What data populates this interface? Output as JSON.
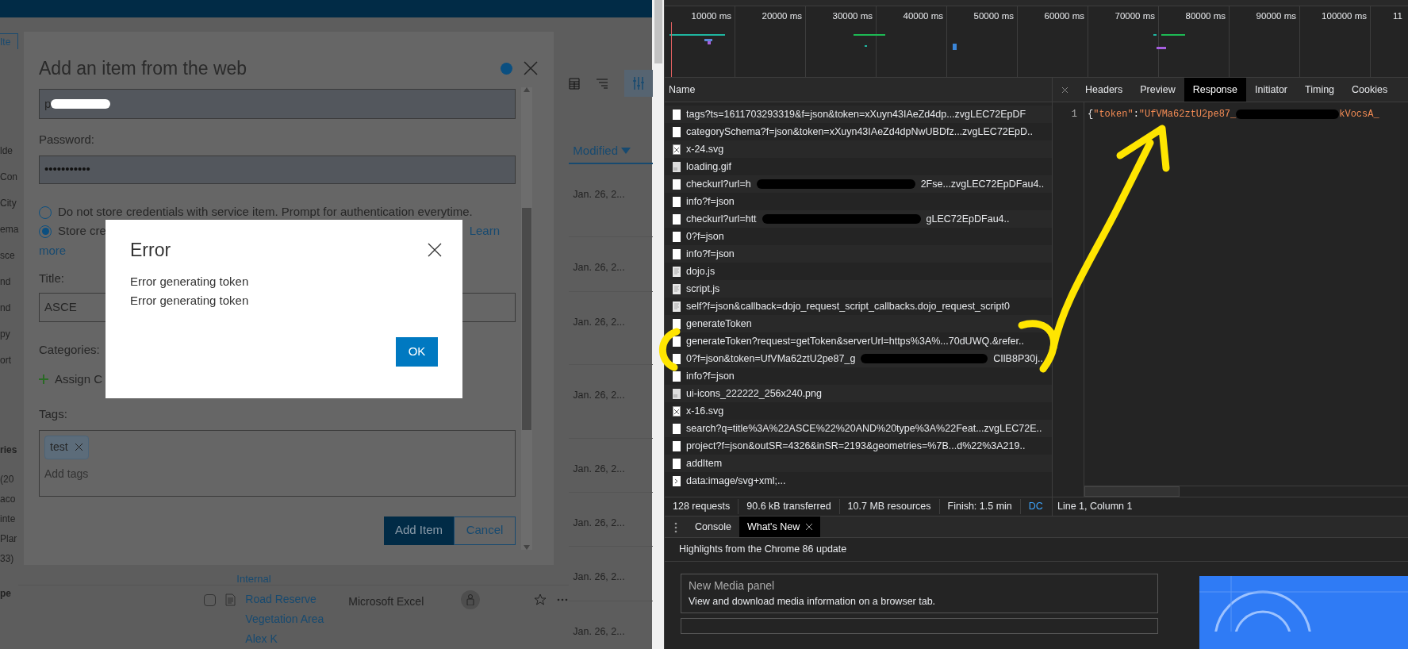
{
  "background_app": {
    "tab_fragment": "Ite",
    "sidebar_fragments_upper": [
      "lde",
      "Con",
      "City",
      "ema",
      "sce",
      "nd",
      "nd",
      "py",
      "ort"
    ],
    "sidebar_fragments_lower": [
      "ries",
      "(20",
      "aco",
      "inte",
      "Plar",
      "33)"
    ],
    "sidebar_fragment_bottom": "pe",
    "sort_header": "Modified",
    "dates": [
      "Jan. 26, 2...",
      "Jan. 26, 2...",
      "Jan. 26, 2...",
      "Jan. 26, 2...",
      "Jan. 26, 2...",
      "Jan. 26, 2...",
      "Jan. 26, 2...",
      "Jan. 26, 2..."
    ],
    "row_fragment": "Internal",
    "item": {
      "checked": false,
      "title_lines": [
        "Road Reserve",
        "Vegetation Area"
      ],
      "owner": "Alex K",
      "type": "Microsoft Excel"
    }
  },
  "dialog": {
    "title": "Add an item from the web",
    "username_value": "p",
    "password_label": "Password:",
    "password_value": "•••••••••••",
    "options": [
      {
        "label": "Do not store credentials with service item. Prompt for authentication everytime.",
        "selected": false
      },
      {
        "label": "Store cre",
        "link": "Learn",
        "link_second_line": "more",
        "selected": true
      }
    ],
    "title_label": "Title:",
    "title_value": "ASCE",
    "categories_label": "Categories:",
    "assign_label": "Assign C",
    "tags_label": "Tags:",
    "tags": [
      "test"
    ],
    "tags_placeholder": "Add tags",
    "buttons": [
      {
        "label": "Add Item",
        "kind": "primary"
      },
      {
        "label": "Cancel",
        "kind": "secondary"
      }
    ]
  },
  "error_modal": {
    "title": "Error",
    "messages": [
      "Error generating token",
      "Error generating token"
    ],
    "button": "OK"
  },
  "devtools": {
    "timeline_ticks": [
      "10000 ms",
      "20000 ms",
      "30000 ms",
      "40000 ms",
      "50000 ms",
      "60000 ms",
      "70000 ms",
      "80000 ms",
      "90000 ms",
      "100000 ms",
      "11"
    ],
    "name_header": "Name",
    "requests": [
      {
        "kind": "doc",
        "name": "tags?ts=1611703293319&f=json&token=xXuyn43IAeZd4dp...zvgLEC72EpDF"
      },
      {
        "kind": "doc",
        "name": "categorySchema?f=json&token=xXuyn43IAeZd4dpNwUBDfz...zvgLEC72EpD.."
      },
      {
        "kind": "x",
        "name": "x-24.svg"
      },
      {
        "kind": "img",
        "name": "loading.gif"
      },
      {
        "kind": "doc",
        "name": "checkurl?url=h",
        "tail": "2Fse...zvgLEC72EpDFau4.."
      },
      {
        "kind": "doc",
        "name": "info?f=json"
      },
      {
        "kind": "doc",
        "name": "checkurl?url=htt",
        "tail": "gLEC72EpDFau4.."
      },
      {
        "kind": "doc",
        "name": "0?f=json"
      },
      {
        "kind": "doc",
        "name": "info?f=json"
      },
      {
        "kind": "script",
        "name": "dojo.js"
      },
      {
        "kind": "script",
        "name": "script.js"
      },
      {
        "kind": "script",
        "name": "self?f=json&callback=dojo_request_script_callbacks.dojo_request_script0"
      },
      {
        "kind": "doc",
        "name": "generateToken"
      },
      {
        "kind": "doc",
        "name": "generateToken?request=getToken&serverUrl=https%3A%...70dUWQ.&refer.."
      },
      {
        "kind": "doc",
        "name": "0?f=json&token=UfVMa62ztU2pe87_g",
        "tail": "CIlB8P30j.."
      },
      {
        "kind": "doc",
        "name": "info?f=json"
      },
      {
        "kind": "img",
        "name": "ui-icons_222222_256x240.png"
      },
      {
        "kind": "x",
        "name": "x-16.svg"
      },
      {
        "kind": "doc",
        "name": "search?q=title%3A%22ASCE%22%20AND%20type%3A%22Feat...zvgLEC72E.."
      },
      {
        "kind": "doc",
        "name": "project?f=json&outSR=4326&inSR=2193&geometries=%7B...d%22%3A219.."
      },
      {
        "kind": "doc",
        "name": "addItem"
      },
      {
        "kind": "arrow",
        "name": "data:image/svg+xml;..."
      }
    ],
    "summary": [
      {
        "text": "128 requests",
        "kind": "plain"
      },
      {
        "text": "90.6 kB transferred",
        "kind": "plain"
      },
      {
        "text": "10.7 MB resources",
        "kind": "plain"
      },
      {
        "text": "Finish: 1.5 min",
        "kind": "plain"
      },
      {
        "text": "DC",
        "kind": "link"
      }
    ],
    "detail_tabs": [
      {
        "label": "Headers",
        "selected": false
      },
      {
        "label": "Preview",
        "selected": false
      },
      {
        "label": "Response",
        "selected": true
      },
      {
        "label": "Initiator",
        "selected": false
      },
      {
        "label": "Timing",
        "selected": false
      },
      {
        "label": "Cookies",
        "selected": false
      }
    ],
    "response": {
      "line_number": "1",
      "tokens": [
        {
          "kind": "punct",
          "text": "{"
        },
        {
          "kind": "string",
          "text": "\"token\""
        },
        {
          "kind": "punct",
          "text": ":"
        },
        {
          "kind": "string",
          "text": "\"UfVMa62ztU2pe87_"
        }
      ],
      "tail": "kVocsA_"
    },
    "cursor_position": "Line 1, Column 1",
    "drawer_tabs": [
      {
        "label": "Console",
        "selected": false,
        "closable": false
      },
      {
        "label": "What's New",
        "selected": true,
        "closable": true
      }
    ],
    "highlights_title": "Highlights from the Chrome 86 update",
    "feature_cards": [
      {
        "title": "New Media panel",
        "description": "View and download media information on a browser tab."
      }
    ]
  }
}
